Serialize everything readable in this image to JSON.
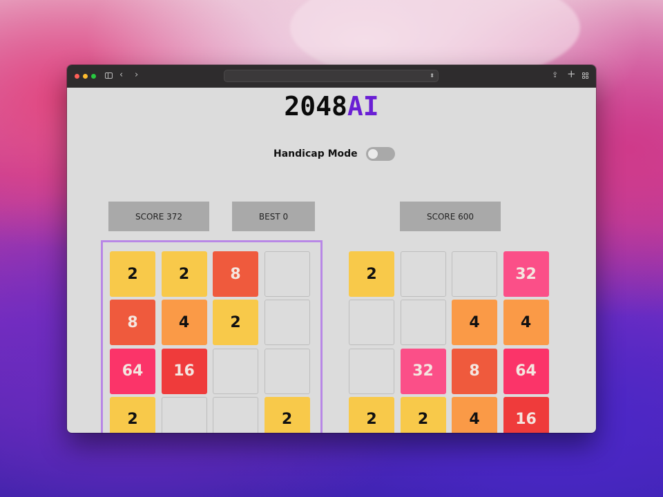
{
  "window": {
    "traffic_lights": [
      "close",
      "minimize",
      "zoom"
    ],
    "url": "",
    "icons": [
      "sidebar-icon",
      "back-icon",
      "forward-icon",
      "share-icon",
      "new-tab-icon",
      "tab-overview-icon"
    ]
  },
  "app": {
    "title_main": "2048",
    "title_accent": "AI",
    "accent_color": "#6a1fd4",
    "handicap_label": "Handicap Mode",
    "handicap_on": false
  },
  "scores": {
    "player_score": "SCORE 372",
    "best": "BEST 0",
    "ai_score": "SCORE 600"
  },
  "tile_colors": {
    "2": {
      "bg": "#f8c94a",
      "fg": "#111111"
    },
    "4": {
      "bg": "#fa9a47",
      "fg": "#111111"
    },
    "8": {
      "bg": "#ef5a3d",
      "fg": "#f4e6e0"
    },
    "16": {
      "bg": "#ef3b3b",
      "fg": "#f4e6e0"
    },
    "32": {
      "bg": "#fb4f88",
      "fg": "#f4e6e0"
    },
    "64": {
      "bg": "#fb3469",
      "fg": "#f4e6e0"
    }
  },
  "boards": {
    "player": [
      [
        "2",
        "2",
        "8",
        ""
      ],
      [
        "8",
        "4",
        "2",
        ""
      ],
      [
        "64",
        "16",
        "",
        ""
      ],
      [
        "2",
        "",
        "",
        "2"
      ]
    ],
    "ai": [
      [
        "2",
        "",
        "",
        "32"
      ],
      [
        "",
        "",
        "4",
        "4"
      ],
      [
        "",
        "32",
        "8",
        "64"
      ],
      [
        "2",
        "2",
        "4",
        "16"
      ]
    ]
  }
}
